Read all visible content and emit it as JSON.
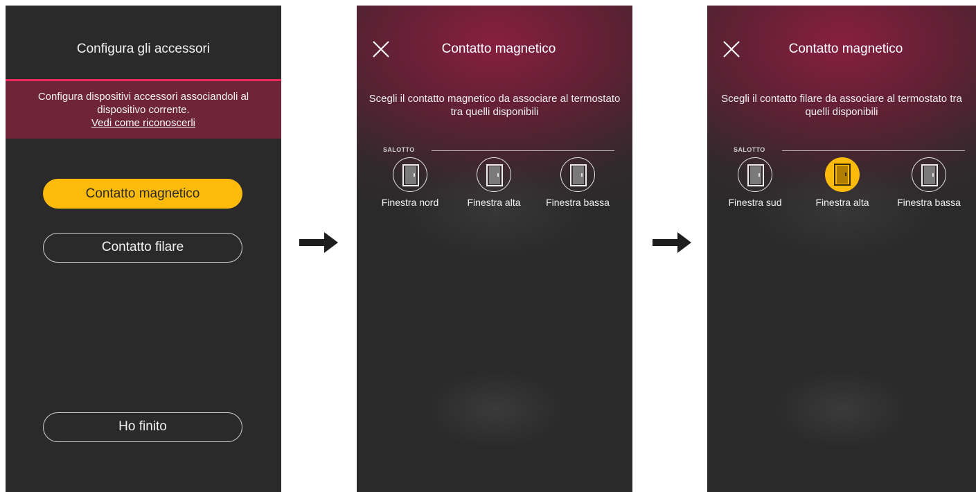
{
  "screen1": {
    "title": "Configura gli accessori",
    "banner_text": "Configura dispositivi accessori associandoli al dispositivo corrente.",
    "banner_link": "Vedi come riconoscerli",
    "btn_magnetic": "Contatto magnetico",
    "btn_wired": "Contatto filare",
    "btn_done": "Ho finito"
  },
  "screen2": {
    "title": "Contatto magnetico",
    "instruction": "Scegli il contatto magnetico da associare al termostato tra quelli disponibili",
    "section": "SALOTTO",
    "devices": [
      {
        "label": "Finestra nord",
        "icon": "door-icon",
        "selected": false
      },
      {
        "label": "Finestra alta",
        "icon": "door-icon",
        "selected": false
      },
      {
        "label": "Finestra bassa",
        "icon": "door-icon",
        "selected": false
      }
    ]
  },
  "screen3": {
    "title": "Contatto magnetico",
    "instruction": "Scegli il contatto filare da associare al termostato tra quelli disponibili",
    "section": "SALOTTO",
    "devices": [
      {
        "label": "Finestra sud",
        "icon": "door-icon",
        "selected": false
      },
      {
        "label": "Finestra alta",
        "icon": "door-icon",
        "selected": true
      },
      {
        "label": "Finestra bassa",
        "icon": "door-icon",
        "selected": false
      }
    ]
  },
  "colors": {
    "background": "#2b2a2b",
    "accent_yellow": "#fcbb0a",
    "accent_pink": "#e8295e",
    "banner": "#6e2538"
  },
  "icons": [
    "close-icon",
    "door-icon",
    "arrow-right-icon"
  ]
}
